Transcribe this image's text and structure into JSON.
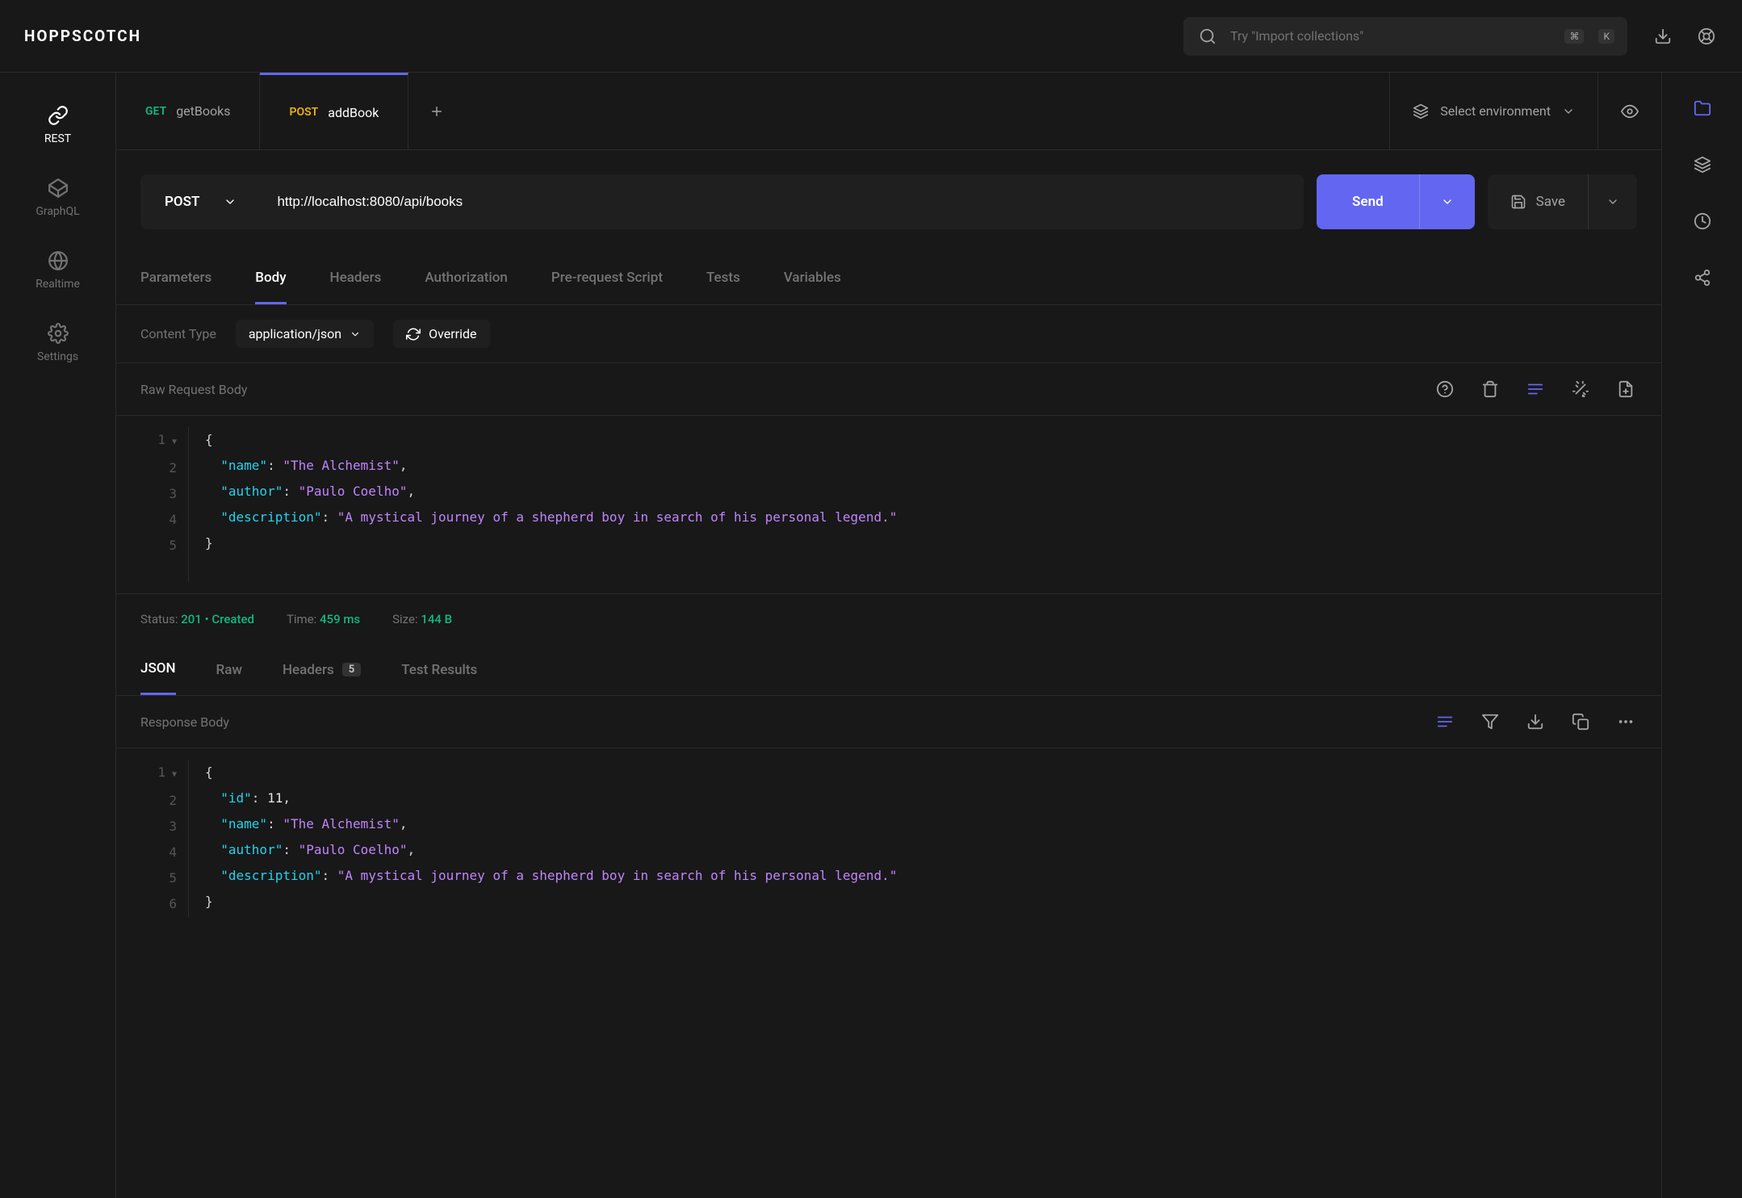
{
  "app": {
    "name": "HOPPSCOTCH"
  },
  "search": {
    "placeholder": "Try \"Import collections\"",
    "kbd1": "⌘",
    "kbd2": "K"
  },
  "sidebar": {
    "items": [
      {
        "label": "REST"
      },
      {
        "label": "GraphQL"
      },
      {
        "label": "Realtime"
      },
      {
        "label": "Settings"
      }
    ]
  },
  "tabs": [
    {
      "method": "GET",
      "name": "getBooks"
    },
    {
      "method": "POST",
      "name": "addBook"
    }
  ],
  "env": {
    "label": "Select environment"
  },
  "request": {
    "method": "POST",
    "url": "http://localhost:8080/api/books",
    "send": "Send",
    "save": "Save"
  },
  "reqTabs": [
    "Parameters",
    "Body",
    "Headers",
    "Authorization",
    "Pre-request Script",
    "Tests",
    "Variables"
  ],
  "contentType": {
    "label": "Content Type",
    "value": "application/json",
    "override": "Override"
  },
  "bodySection": {
    "title": "Raw Request Body"
  },
  "requestBody": {
    "name": "The Alchemist",
    "author": "Paulo Coelho",
    "description": "A mystical journey of a shepherd boy in search of his personal legend."
  },
  "status": {
    "statusLabel": "Status:",
    "statusCode": "201",
    "statusText": "Created",
    "timeLabel": "Time:",
    "timeValue": "459 ms",
    "sizeLabel": "Size:",
    "sizeValue": "144 B"
  },
  "respTabs": {
    "json": "JSON",
    "raw": "Raw",
    "headers": "Headers",
    "headersCount": "5",
    "testResults": "Test Results"
  },
  "respSection": {
    "title": "Response Body"
  },
  "responseBody": {
    "id": 11,
    "name": "The Alchemist",
    "author": "Paulo Coelho",
    "description": "A mystical journey of a shepherd boy in search of his personal legend."
  }
}
